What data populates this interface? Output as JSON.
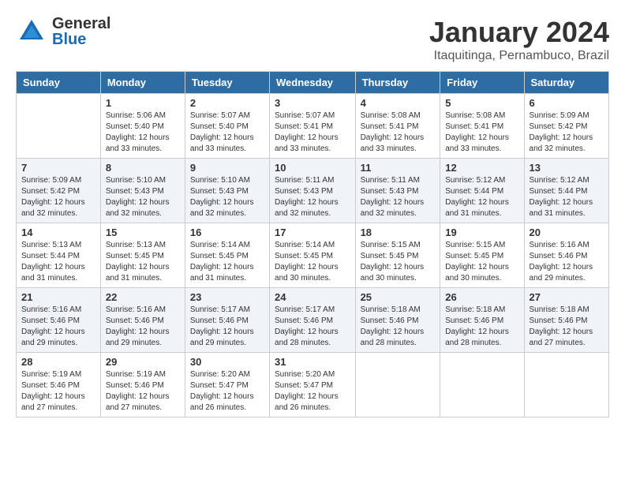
{
  "header": {
    "logo_general": "General",
    "logo_blue": "Blue",
    "month_title": "January 2024",
    "location": "Itaquitinga, Pernambuco, Brazil"
  },
  "days_of_week": [
    "Sunday",
    "Monday",
    "Tuesday",
    "Wednesday",
    "Thursday",
    "Friday",
    "Saturday"
  ],
  "weeks": [
    {
      "rowBg": "odd",
      "days": [
        {
          "num": "",
          "sunrise": "",
          "sunset": "",
          "daylight": ""
        },
        {
          "num": "1",
          "sunrise": "Sunrise: 5:06 AM",
          "sunset": "Sunset: 5:40 PM",
          "daylight": "Daylight: 12 hours",
          "daylight2": "and 33 minutes."
        },
        {
          "num": "2",
          "sunrise": "Sunrise: 5:07 AM",
          "sunset": "Sunset: 5:40 PM",
          "daylight": "Daylight: 12 hours",
          "daylight2": "and 33 minutes."
        },
        {
          "num": "3",
          "sunrise": "Sunrise: 5:07 AM",
          "sunset": "Sunset: 5:41 PM",
          "daylight": "Daylight: 12 hours",
          "daylight2": "and 33 minutes."
        },
        {
          "num": "4",
          "sunrise": "Sunrise: 5:08 AM",
          "sunset": "Sunset: 5:41 PM",
          "daylight": "Daylight: 12 hours",
          "daylight2": "and 33 minutes."
        },
        {
          "num": "5",
          "sunrise": "Sunrise: 5:08 AM",
          "sunset": "Sunset: 5:41 PM",
          "daylight": "Daylight: 12 hours",
          "daylight2": "and 33 minutes."
        },
        {
          "num": "6",
          "sunrise": "Sunrise: 5:09 AM",
          "sunset": "Sunset: 5:42 PM",
          "daylight": "Daylight: 12 hours",
          "daylight2": "and 32 minutes."
        }
      ]
    },
    {
      "rowBg": "even",
      "days": [
        {
          "num": "7",
          "sunrise": "Sunrise: 5:09 AM",
          "sunset": "Sunset: 5:42 PM",
          "daylight": "Daylight: 12 hours",
          "daylight2": "and 32 minutes."
        },
        {
          "num": "8",
          "sunrise": "Sunrise: 5:10 AM",
          "sunset": "Sunset: 5:43 PM",
          "daylight": "Daylight: 12 hours",
          "daylight2": "and 32 minutes."
        },
        {
          "num": "9",
          "sunrise": "Sunrise: 5:10 AM",
          "sunset": "Sunset: 5:43 PM",
          "daylight": "Daylight: 12 hours",
          "daylight2": "and 32 minutes."
        },
        {
          "num": "10",
          "sunrise": "Sunrise: 5:11 AM",
          "sunset": "Sunset: 5:43 PM",
          "daylight": "Daylight: 12 hours",
          "daylight2": "and 32 minutes."
        },
        {
          "num": "11",
          "sunrise": "Sunrise: 5:11 AM",
          "sunset": "Sunset: 5:43 PM",
          "daylight": "Daylight: 12 hours",
          "daylight2": "and 32 minutes."
        },
        {
          "num": "12",
          "sunrise": "Sunrise: 5:12 AM",
          "sunset": "Sunset: 5:44 PM",
          "daylight": "Daylight: 12 hours",
          "daylight2": "and 31 minutes."
        },
        {
          "num": "13",
          "sunrise": "Sunrise: 5:12 AM",
          "sunset": "Sunset: 5:44 PM",
          "daylight": "Daylight: 12 hours",
          "daylight2": "and 31 minutes."
        }
      ]
    },
    {
      "rowBg": "odd",
      "days": [
        {
          "num": "14",
          "sunrise": "Sunrise: 5:13 AM",
          "sunset": "Sunset: 5:44 PM",
          "daylight": "Daylight: 12 hours",
          "daylight2": "and 31 minutes."
        },
        {
          "num": "15",
          "sunrise": "Sunrise: 5:13 AM",
          "sunset": "Sunset: 5:45 PM",
          "daylight": "Daylight: 12 hours",
          "daylight2": "and 31 minutes."
        },
        {
          "num": "16",
          "sunrise": "Sunrise: 5:14 AM",
          "sunset": "Sunset: 5:45 PM",
          "daylight": "Daylight: 12 hours",
          "daylight2": "and 31 minutes."
        },
        {
          "num": "17",
          "sunrise": "Sunrise: 5:14 AM",
          "sunset": "Sunset: 5:45 PM",
          "daylight": "Daylight: 12 hours",
          "daylight2": "and 30 minutes."
        },
        {
          "num": "18",
          "sunrise": "Sunrise: 5:15 AM",
          "sunset": "Sunset: 5:45 PM",
          "daylight": "Daylight: 12 hours",
          "daylight2": "and 30 minutes."
        },
        {
          "num": "19",
          "sunrise": "Sunrise: 5:15 AM",
          "sunset": "Sunset: 5:45 PM",
          "daylight": "Daylight: 12 hours",
          "daylight2": "and 30 minutes."
        },
        {
          "num": "20",
          "sunrise": "Sunrise: 5:16 AM",
          "sunset": "Sunset: 5:46 PM",
          "daylight": "Daylight: 12 hours",
          "daylight2": "and 29 minutes."
        }
      ]
    },
    {
      "rowBg": "even",
      "days": [
        {
          "num": "21",
          "sunrise": "Sunrise: 5:16 AM",
          "sunset": "Sunset: 5:46 PM",
          "daylight": "Daylight: 12 hours",
          "daylight2": "and 29 minutes."
        },
        {
          "num": "22",
          "sunrise": "Sunrise: 5:16 AM",
          "sunset": "Sunset: 5:46 PM",
          "daylight": "Daylight: 12 hours",
          "daylight2": "and 29 minutes."
        },
        {
          "num": "23",
          "sunrise": "Sunrise: 5:17 AM",
          "sunset": "Sunset: 5:46 PM",
          "daylight": "Daylight: 12 hours",
          "daylight2": "and 29 minutes."
        },
        {
          "num": "24",
          "sunrise": "Sunrise: 5:17 AM",
          "sunset": "Sunset: 5:46 PM",
          "daylight": "Daylight: 12 hours",
          "daylight2": "and 28 minutes."
        },
        {
          "num": "25",
          "sunrise": "Sunrise: 5:18 AM",
          "sunset": "Sunset: 5:46 PM",
          "daylight": "Daylight: 12 hours",
          "daylight2": "and 28 minutes."
        },
        {
          "num": "26",
          "sunrise": "Sunrise: 5:18 AM",
          "sunset": "Sunset: 5:46 PM",
          "daylight": "Daylight: 12 hours",
          "daylight2": "and 28 minutes."
        },
        {
          "num": "27",
          "sunrise": "Sunrise: 5:18 AM",
          "sunset": "Sunset: 5:46 PM",
          "daylight": "Daylight: 12 hours",
          "daylight2": "and 27 minutes."
        }
      ]
    },
    {
      "rowBg": "odd",
      "days": [
        {
          "num": "28",
          "sunrise": "Sunrise: 5:19 AM",
          "sunset": "Sunset: 5:46 PM",
          "daylight": "Daylight: 12 hours",
          "daylight2": "and 27 minutes."
        },
        {
          "num": "29",
          "sunrise": "Sunrise: 5:19 AM",
          "sunset": "Sunset: 5:46 PM",
          "daylight": "Daylight: 12 hours",
          "daylight2": "and 27 minutes."
        },
        {
          "num": "30",
          "sunrise": "Sunrise: 5:20 AM",
          "sunset": "Sunset: 5:47 PM",
          "daylight": "Daylight: 12 hours",
          "daylight2": "and 26 minutes."
        },
        {
          "num": "31",
          "sunrise": "Sunrise: 5:20 AM",
          "sunset": "Sunset: 5:47 PM",
          "daylight": "Daylight: 12 hours",
          "daylight2": "and 26 minutes."
        },
        {
          "num": "",
          "sunrise": "",
          "sunset": "",
          "daylight": "",
          "daylight2": ""
        },
        {
          "num": "",
          "sunrise": "",
          "sunset": "",
          "daylight": "",
          "daylight2": ""
        },
        {
          "num": "",
          "sunrise": "",
          "sunset": "",
          "daylight": "",
          "daylight2": ""
        }
      ]
    }
  ]
}
